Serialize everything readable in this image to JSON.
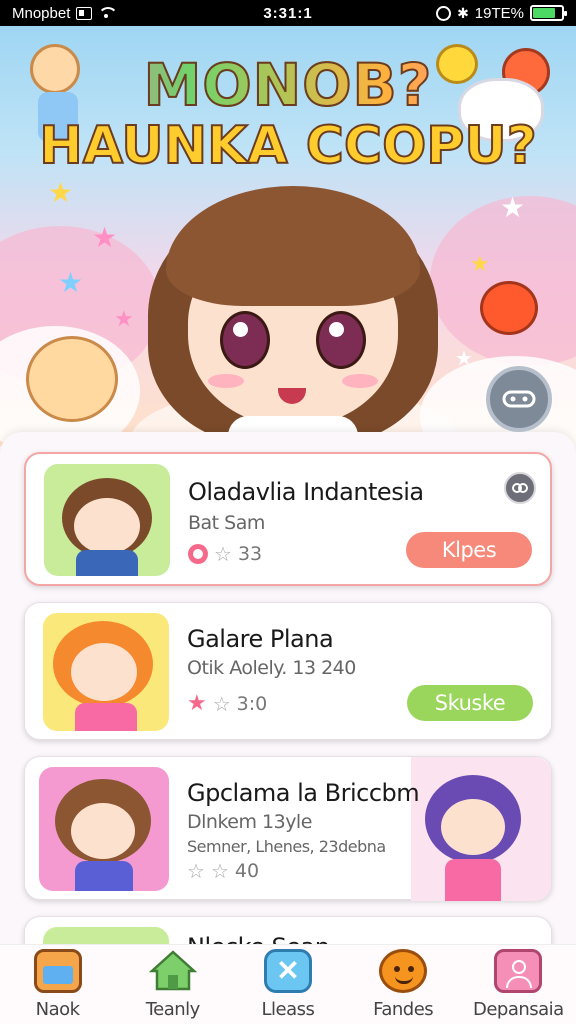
{
  "status_bar": {
    "carrier": "Mnopbet",
    "time": "3:31:1",
    "battery_text": "19TE%"
  },
  "hero": {
    "title_line1": "MONOB?",
    "title_line2": "HAUNKA CCOPU?"
  },
  "cards": [
    {
      "title": "Oladavlia Indantesia",
      "subtitle": "Bat Sam",
      "rating": "33",
      "button_label": "Klpes",
      "button_color": "#f7897a",
      "selected": true
    },
    {
      "title": "Galare Plana",
      "subtitle": "Otik Aolely. 13 240",
      "rating": "3:0",
      "button_label": "Skuske",
      "button_color": "#9bd65c",
      "selected": false
    },
    {
      "title": "Gpclama la Briccbm",
      "subtitle": "Dlnkem 13yle",
      "subtitle2": "Semner, Lhenes, 23debna",
      "rating": "40",
      "selected": false
    },
    {
      "title": "Nlecke Sean"
    }
  ],
  "bottom_nav": [
    {
      "label": "Naok",
      "icon": "shop-icon",
      "color": "#f5a54a"
    },
    {
      "label": "Teanly",
      "icon": "home-icon",
      "color": "#7ccf6a"
    },
    {
      "label": "Lleass",
      "icon": "close-icon",
      "color": "#6cc6f2"
    },
    {
      "label": "Fandes",
      "icon": "smiley-icon",
      "color": "#f5941e"
    },
    {
      "label": "Depansaia",
      "icon": "profile-icon",
      "color": "#f58fb8"
    }
  ]
}
